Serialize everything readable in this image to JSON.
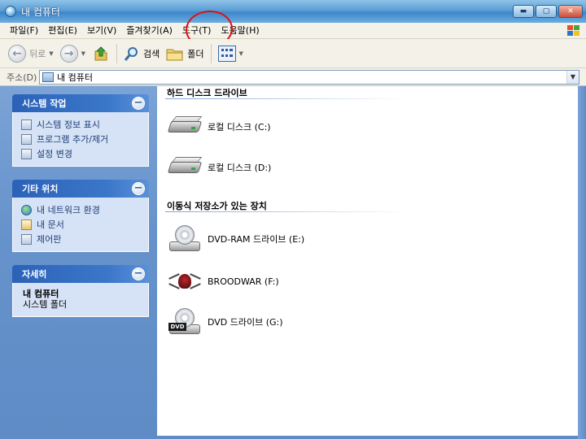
{
  "window": {
    "title": "내 컴퓨터"
  },
  "menu": {
    "items": [
      "파일(F)",
      "편집(E)",
      "보기(V)",
      "즐겨찾기(A)",
      "도구(T)",
      "도움말(H)"
    ]
  },
  "toolbar": {
    "back_label": "뒤로",
    "search_label": "검색",
    "folders_label": "폴더"
  },
  "address": {
    "label": "주소(D)",
    "value": "내 컴퓨터"
  },
  "sidebar": {
    "system_tasks": {
      "title": "시스템 작업",
      "items": [
        {
          "label": "시스템 정보 표시",
          "icon": "system-info-icon"
        },
        {
          "label": "프로그램 추가/제거",
          "icon": "add-remove-programs-icon"
        },
        {
          "label": "설정 변경",
          "icon": "settings-icon"
        }
      ]
    },
    "other_places": {
      "title": "기타 위치",
      "items": [
        {
          "label": "내 네트워크 환경",
          "icon": "network-icon"
        },
        {
          "label": "내 문서",
          "icon": "my-documents-icon"
        },
        {
          "label": "제어판",
          "icon": "control-panel-icon"
        }
      ]
    },
    "details": {
      "title": "자세히",
      "name": "내 컴퓨터",
      "type": "시스템 폴더"
    }
  },
  "content": {
    "hard_disks": {
      "title": "하드 디스크 드라이브",
      "drives": [
        {
          "label": "로컬 디스크 (C:)",
          "icon": "hard-disk-icon"
        },
        {
          "label": "로컬 디스크 (D:)",
          "icon": "hard-disk-icon"
        }
      ]
    },
    "removable": {
      "title": "이동식 저장소가 있는 장치",
      "drives": [
        {
          "label": "DVD-RAM 드라이브 (E:)",
          "icon": "cd-drive-icon"
        },
        {
          "label": "BROODWAR (F:)",
          "icon": "broodwar-disc-icon"
        },
        {
          "label": "DVD 드라이브 (G:)",
          "icon": "dvd-drive-icon",
          "badge": "DVD"
        }
      ]
    }
  },
  "colors": {
    "highlight_ring": "#e01010",
    "sidebar_bg": "#6793cc",
    "panel_header": "#2b62b8"
  }
}
